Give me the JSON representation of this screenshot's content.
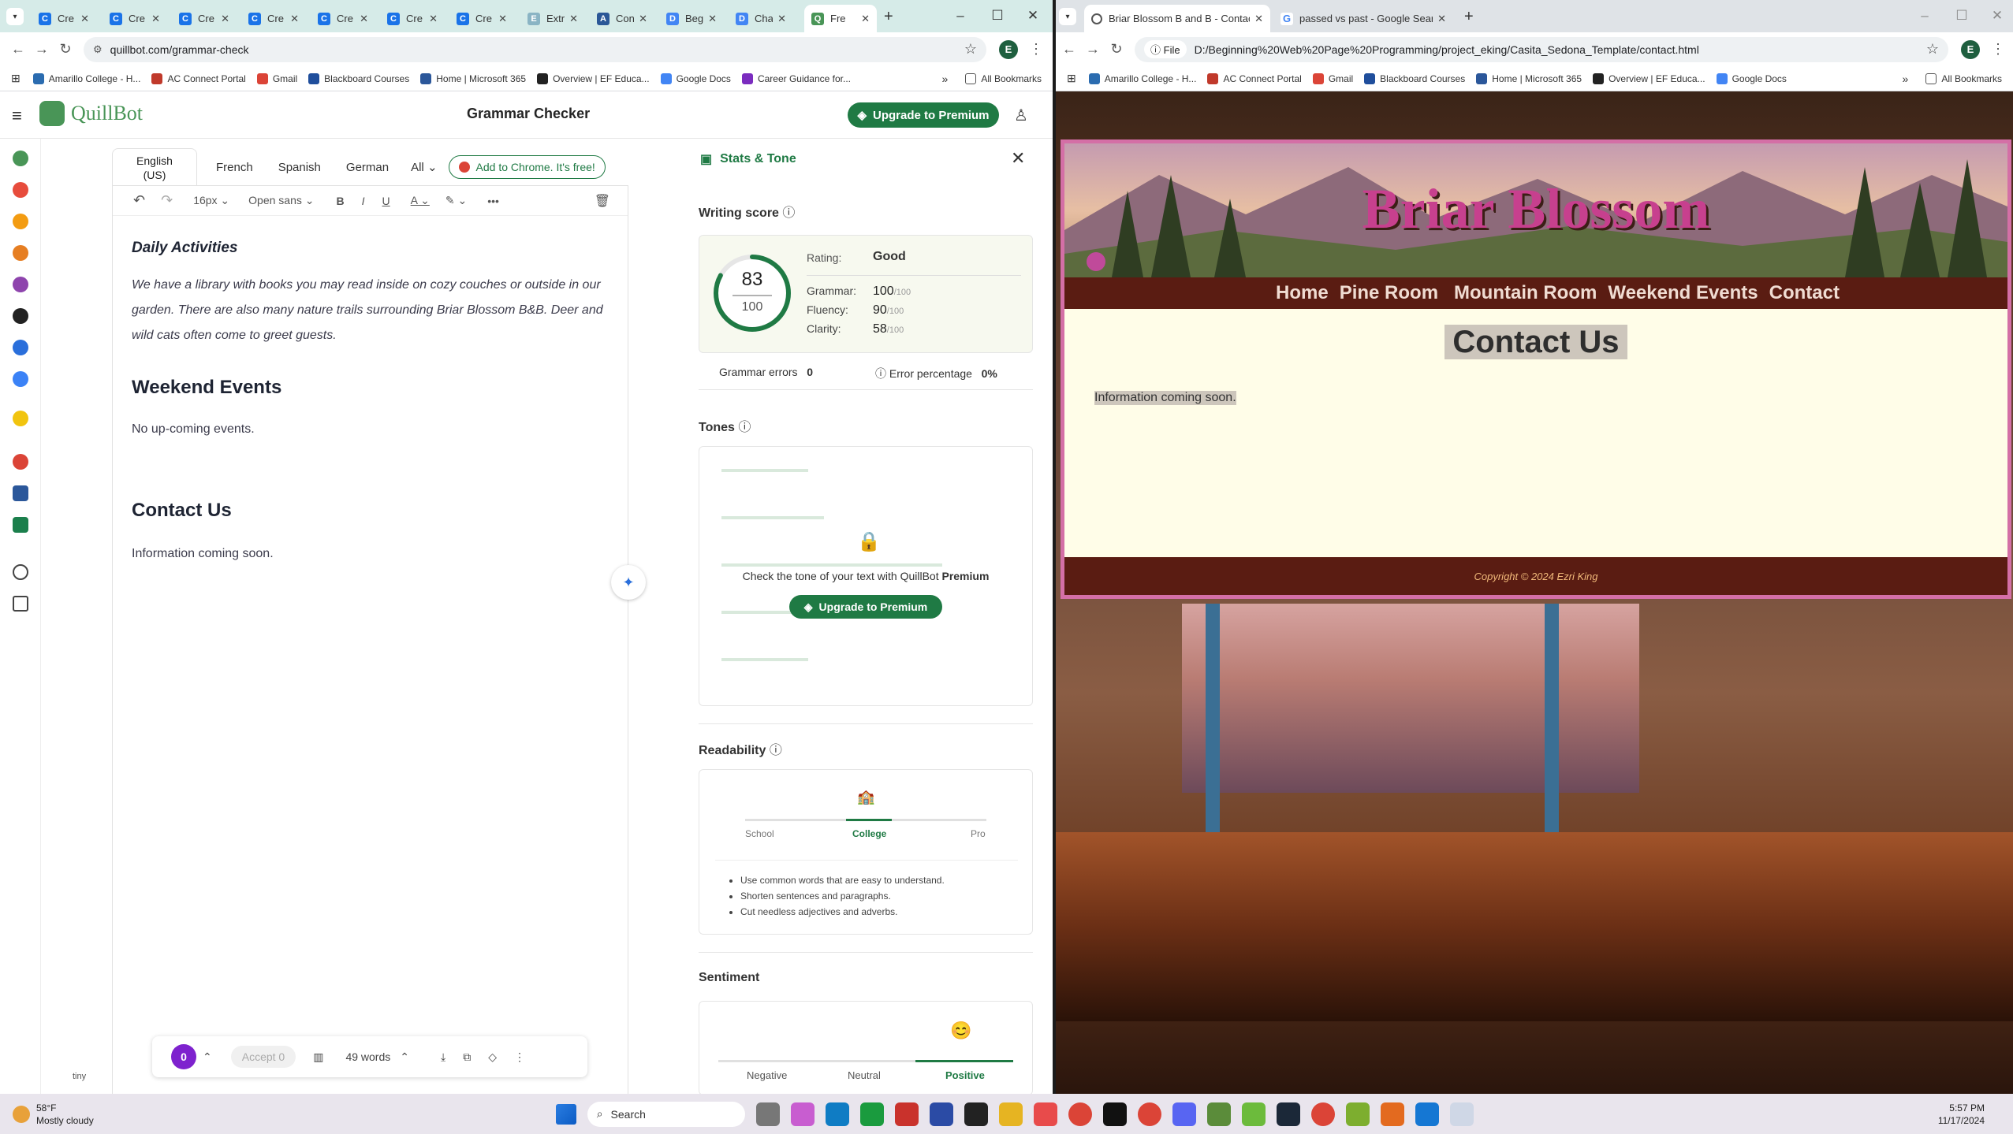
{
  "left_window": {
    "tabs": [
      {
        "label": "Cre",
        "color": "#1a73e8",
        "glyph": "C"
      },
      {
        "label": "Cre",
        "color": "#1a73e8",
        "glyph": "C"
      },
      {
        "label": "Cre",
        "color": "#1a73e8",
        "glyph": "C"
      },
      {
        "label": "Cre",
        "color": "#1a73e8",
        "glyph": "C"
      },
      {
        "label": "Cre",
        "color": "#1a73e8",
        "glyph": "C"
      },
      {
        "label": "Cre",
        "color": "#1a73e8",
        "glyph": "C"
      },
      {
        "label": "Cre",
        "color": "#1a73e8",
        "glyph": "C"
      },
      {
        "label": "Extract",
        "color": "#8ab4c4",
        "glyph": "E"
      },
      {
        "label": "Conten",
        "color": "#2b5797",
        "glyph": "A"
      },
      {
        "label": "Beginn",
        "color": "#4285f4",
        "glyph": "D"
      },
      {
        "label": "Chapte",
        "color": "#4285f4",
        "glyph": "D"
      },
      {
        "label": "Fre",
        "color": "#499557",
        "glyph": "Q"
      }
    ],
    "url": "quillbot.com/grammar-check",
    "profile_initial": "E",
    "bookmarks": [
      "Amarillo College - H...",
      "AC Connect Portal",
      "Gmail",
      "Blackboard Courses",
      "Home | Microsoft 365",
      "Overview | EF Educa...",
      "Google Docs",
      "Career Guidance for..."
    ],
    "all_bookmarks": "All Bookmarks"
  },
  "quillbot": {
    "logo_text": "QuillBot",
    "page_title": "Grammar Checker",
    "upgrade_label": "Upgrade to Premium",
    "languages": [
      "English (US)",
      "French",
      "Spanish",
      "German",
      "All"
    ],
    "chrome_ext": "Add to Chrome. It's free!",
    "toolbar": {
      "font_size": "16px",
      "font_family": "Open sans"
    },
    "doc": {
      "h_daily": "Daily Activities",
      "p_daily": "We have a library with books you may read inside on cozy couches or outside in our garden. There are also many nature trails surrounding Briar Blossom B&B. Deer and wild cats often come to greet guests.",
      "h_weekend": "Weekend Events",
      "p_weekend": "No up-coming events.",
      "h_contact": "Contact Us",
      "p_contact": "Information coming soon."
    },
    "bottom": {
      "issues": "0",
      "accept": "Accept 0",
      "words": "49 words"
    },
    "tiny_label": "tiny",
    "stats": {
      "title": "Stats & Tone",
      "writing_score_label": "Writing score",
      "score": "83",
      "score_max": "100",
      "score_fraction": 0.83,
      "rating_label": "Rating:",
      "rating": "Good",
      "metrics": [
        {
          "name": "Grammar:",
          "value": "100",
          "max": "/100"
        },
        {
          "name": "Fluency:",
          "value": "90",
          "max": "/100"
        },
        {
          "name": "Clarity:",
          "value": "58",
          "max": "/100"
        }
      ],
      "grammar_errors_label": "Grammar errors",
      "grammar_errors": "0",
      "error_pct_label": "Error percentage",
      "error_pct": "0%",
      "tones_label": "Tones",
      "tone_lock_text": "Check the tone of your text with QuillBot",
      "tone_lock_strong": "Premium",
      "tone_upgrade": "Upgrade to Premium",
      "readability_label": "Readability",
      "read_levels": [
        "School",
        "College",
        "Pro"
      ],
      "read_tips": [
        "Use common words that are easy to understand.",
        "Shorten sentences and paragraphs.",
        "Cut needless adjectives and adverbs."
      ],
      "sentiment_label": "Sentiment",
      "sentiment_levels": [
        "Negative",
        "Neutral",
        "Positive"
      ]
    }
  },
  "right_window": {
    "tabs": [
      {
        "label": "Briar Blossom B and B - Contact"
      },
      {
        "label": "passed vs past - Google Search"
      }
    ],
    "url_prefix": "File",
    "url": "D:/Beginning%20Web%20Page%20Programming/project_eking/Casita_Sedona_Template/contact.html",
    "profile_initial": "E",
    "bookmarks": [
      "Amarillo College - H...",
      "AC Connect Portal",
      "Gmail",
      "Blackboard Courses",
      "Home | Microsoft 365",
      "Overview | EF Educa...",
      "Google Docs"
    ],
    "all_bookmarks": "All Bookmarks"
  },
  "briar": {
    "title": "Briar Blossom",
    "nav": [
      "Home",
      "Pine Room",
      "Mountain Room",
      "Weekend Events",
      "Contact"
    ],
    "heading": "Contact Us",
    "body": "Information coming soon.",
    "footer": "Copyright © 2024 Ezri King"
  },
  "taskbar": {
    "weather_temp": "58°F",
    "weather_desc": "Mostly cloudy",
    "search": "Search",
    "time": "5:57 PM",
    "date": "11/17/2024"
  }
}
